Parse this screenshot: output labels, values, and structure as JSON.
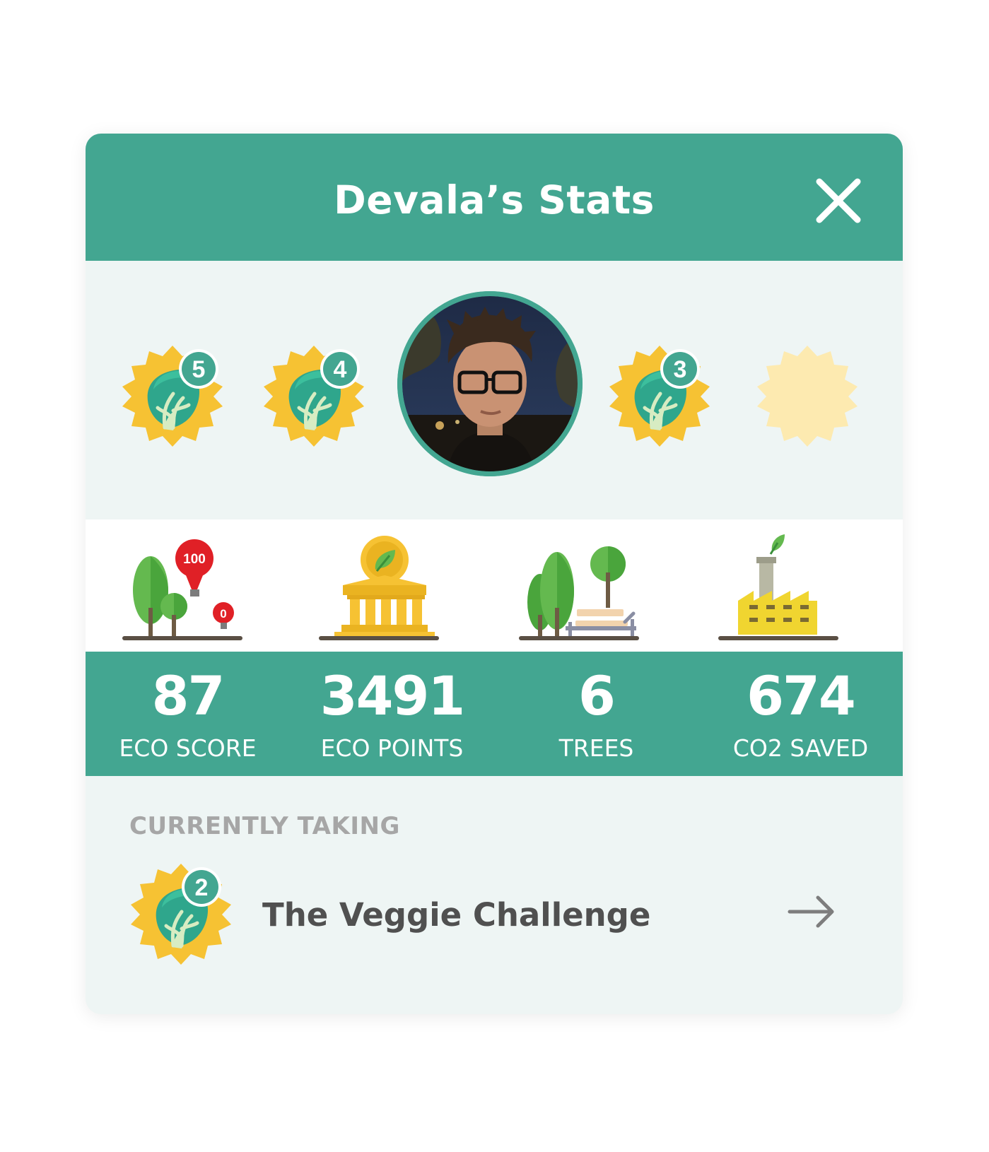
{
  "header": {
    "title": "Devala’s Stats"
  },
  "badges": [
    {
      "level": "5",
      "earned": true
    },
    {
      "level": "4",
      "earned": true
    },
    {
      "level": "3",
      "earned": true
    },
    {
      "level": "",
      "earned": false
    }
  ],
  "tree_icon_markers": {
    "high": "100",
    "low": "0"
  },
  "stats": [
    {
      "value": "87",
      "label": "ECO SCORE",
      "icon": "trees-balloon-icon"
    },
    {
      "value": "3491",
      "label": "ECO POINTS",
      "icon": "bank-coin-icon"
    },
    {
      "value": "6",
      "label": "TREES",
      "icon": "park-bench-icon"
    },
    {
      "value": "674",
      "label": "CO2 SAVED",
      "icon": "factory-leaf-icon"
    }
  ],
  "current": {
    "heading": "CURRENTLY TAKING",
    "challenge_name": "The Veggie Challenge",
    "challenge_level": "2"
  },
  "colors": {
    "brand_green": "#43a691",
    "badge_yellow": "#f6c233",
    "badge_yellow_locked": "#fdeab0",
    "leaf_green": "#2fa68c",
    "alert_red": "#e02026"
  }
}
